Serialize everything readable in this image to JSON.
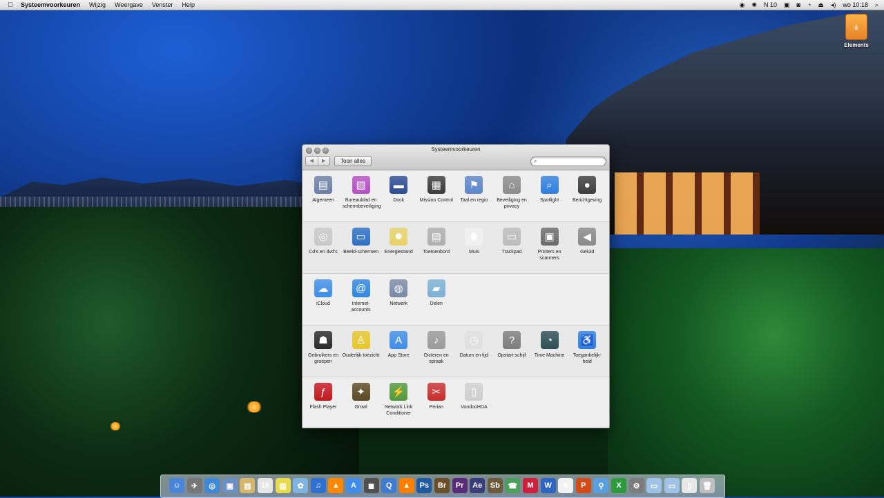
{
  "menubar": {
    "apple": "",
    "app_name": "Systeemvoorkeuren",
    "items": [
      "Wijzig",
      "Weergave",
      "Venster",
      "Help"
    ],
    "status": {
      "battery_text": "10",
      "clock": "wo 10:18"
    }
  },
  "desktop": {
    "drive_label": "Elements"
  },
  "window": {
    "title": "Systeemvoorkeuren",
    "show_all": "Toon alles",
    "search": {
      "value": "",
      "placeholder": ""
    },
    "sections": [
      {
        "panes": [
          {
            "label": "Algemeen",
            "icon": "general-icon",
            "color": "#6c7fa8"
          },
          {
            "label": "Bureaublad en schermbeveiliging",
            "icon": "desktop-screensaver-icon",
            "color": "#b44fc6"
          },
          {
            "label": "Dock",
            "icon": "dock-icon",
            "color": "#2b4c93"
          },
          {
            "label": "Mission Control",
            "icon": "mission-control-icon",
            "color": "#3a3a3a"
          },
          {
            "label": "Taal en regio",
            "icon": "language-region-icon",
            "color": "#5d86c9"
          },
          {
            "label": "Beveiliging en privacy",
            "icon": "security-privacy-icon",
            "color": "#8c8c8c"
          },
          {
            "label": "Spotlight",
            "icon": "spotlight-icon",
            "color": "#2f7fe0"
          },
          {
            "label": "Berichtgeving",
            "icon": "notifications-icon",
            "color": "#3d3d3d"
          }
        ]
      },
      {
        "panes": [
          {
            "label": "Cd's en dvd's",
            "icon": "cd-dvd-icon",
            "color": "#c9c9c9"
          },
          {
            "label": "Beeld-schermen",
            "icon": "displays-icon",
            "color": "#2d6fc4"
          },
          {
            "label": "Energiestand",
            "icon": "energy-saver-icon",
            "color": "#e8d36a"
          },
          {
            "label": "Toetsenbord",
            "icon": "keyboard-icon",
            "color": "#b0b0b0"
          },
          {
            "label": "Muis",
            "icon": "mouse-icon",
            "color": "#f1f1f1"
          },
          {
            "label": "Trackpad",
            "icon": "trackpad-icon",
            "color": "#bdbdbd"
          },
          {
            "label": "Printers en scanners",
            "icon": "printer-icon",
            "color": "#6b6b6b"
          },
          {
            "label": "Geluid",
            "icon": "sound-icon",
            "color": "#8a8a8a"
          }
        ]
      },
      {
        "panes": [
          {
            "label": "iCloud",
            "icon": "icloud-icon",
            "color": "#3f8de8"
          },
          {
            "label": "Internet-accounts",
            "icon": "internet-accounts-icon",
            "color": "#2f86e0"
          },
          {
            "label": "Netwerk",
            "icon": "network-icon",
            "color": "#7a8aa6"
          },
          {
            "label": "Delen",
            "icon": "sharing-icon",
            "color": "#7cb1d6"
          }
        ]
      },
      {
        "panes": [
          {
            "label": "Gebruikers en groepen",
            "icon": "users-groups-icon",
            "color": "#2a2a2a"
          },
          {
            "label": "Ouderlijk toezicht",
            "icon": "parental-controls-icon",
            "color": "#e8c72b"
          },
          {
            "label": "App Store",
            "icon": "app-store-icon",
            "color": "#3f8de8"
          },
          {
            "label": "Dicteren en spraak",
            "icon": "dictation-speech-icon",
            "color": "#9a9a9a"
          },
          {
            "label": "Datum en tijd",
            "icon": "date-time-icon",
            "color": "#e0e0e0"
          },
          {
            "label": "Opstart-schijf",
            "icon": "startup-disk-icon",
            "color": "#7d7d7d"
          },
          {
            "label": "Time Machine",
            "icon": "time-machine-icon",
            "color": "#2d4f55"
          },
          {
            "label": "Toegankelijk-heid",
            "icon": "accessibility-icon",
            "color": "#2f7fe0"
          }
        ]
      },
      {
        "panes": [
          {
            "label": "Flash Player",
            "icon": "flash-player-icon",
            "color": "#c4171d"
          },
          {
            "label": "Growl",
            "icon": "growl-icon",
            "color": "#5b4a22"
          },
          {
            "label": "Network Link Conditioner",
            "icon": "network-link-conditioner-icon",
            "color": "#4f9a3c"
          },
          {
            "label": "Perian",
            "icon": "perian-icon",
            "color": "#c92d2d"
          },
          {
            "label": "VoodooHDA",
            "icon": "voodoohda-icon",
            "color": "#cfcfcf"
          }
        ]
      }
    ]
  },
  "dock": {
    "apps": [
      {
        "icon": "finder-icon",
        "glyph": "☺",
        "color": "#4a86d8"
      },
      {
        "icon": "launchpad-icon",
        "glyph": "✈",
        "color": "#777"
      },
      {
        "icon": "safari-icon",
        "glyph": "◎",
        "color": "#3e88d6"
      },
      {
        "icon": "preview-icon",
        "glyph": "▣",
        "color": "#6b8fc1"
      },
      {
        "icon": "notes-icon",
        "glyph": "▤",
        "color": "#d7b56b"
      },
      {
        "icon": "calendar-icon",
        "glyph": "16",
        "color": "#e6e6e6"
      },
      {
        "icon": "stickies-icon",
        "glyph": "▥",
        "color": "#e8dc4a"
      },
      {
        "icon": "photos-icon",
        "glyph": "✿",
        "color": "#7db4e0"
      },
      {
        "icon": "itunes-icon",
        "glyph": "♫",
        "color": "#2f6fd0"
      },
      {
        "icon": "vlc-icon",
        "glyph": "▲",
        "color": "#ff8800"
      },
      {
        "icon": "app-store-dock-icon",
        "glyph": "A",
        "color": "#3f8de8"
      },
      {
        "icon": "screenshot-icon",
        "glyph": "◼",
        "color": "#505050"
      },
      {
        "icon": "quicktime-icon",
        "glyph": "Q",
        "color": "#3f7bd0"
      },
      {
        "icon": "cone-icon",
        "glyph": "▲",
        "color": "#ff7f00"
      },
      {
        "icon": "photoshop-icon",
        "glyph": "Ps",
        "color": "#1f5a9e"
      },
      {
        "icon": "bridge-icon",
        "glyph": "Br",
        "color": "#6b4f2a"
      },
      {
        "icon": "premiere-icon",
        "glyph": "Pr",
        "color": "#5a2b77"
      },
      {
        "icon": "after-effects-icon",
        "glyph": "Ae",
        "color": "#3b3d7a"
      },
      {
        "icon": "soundbooth-icon",
        "glyph": "Sb",
        "color": "#6b5a3b"
      },
      {
        "icon": "facetime-icon",
        "glyph": "☎",
        "color": "#4aa05a"
      },
      {
        "icon": "mail-client-icon",
        "glyph": "M",
        "color": "#d01f3c"
      },
      {
        "icon": "word-icon",
        "glyph": "W",
        "color": "#2d65c4"
      },
      {
        "icon": "textedit-icon",
        "glyph": "✎",
        "color": "#f2f2f2"
      },
      {
        "icon": "powerpoint-icon",
        "glyph": "P",
        "color": "#d24b16"
      },
      {
        "icon": "pin-icon",
        "glyph": "⚲",
        "color": "#5aa0e0"
      },
      {
        "icon": "excel-icon",
        "glyph": "X",
        "color": "#2e9a3e"
      },
      {
        "icon": "system-prefs-dock-icon",
        "glyph": "⚙",
        "color": "#7c7c7c"
      },
      {
        "icon": "folder-icon",
        "glyph": "▭",
        "color": "#9fc2e6"
      },
      {
        "icon": "documents-folder-icon",
        "glyph": "▭",
        "color": "#9fc2e6"
      },
      {
        "icon": "file-icon",
        "glyph": "▯",
        "color": "#e8e8e8"
      },
      {
        "icon": "trash-icon",
        "glyph": "🗑",
        "color": "#bfbfbf"
      }
    ]
  }
}
